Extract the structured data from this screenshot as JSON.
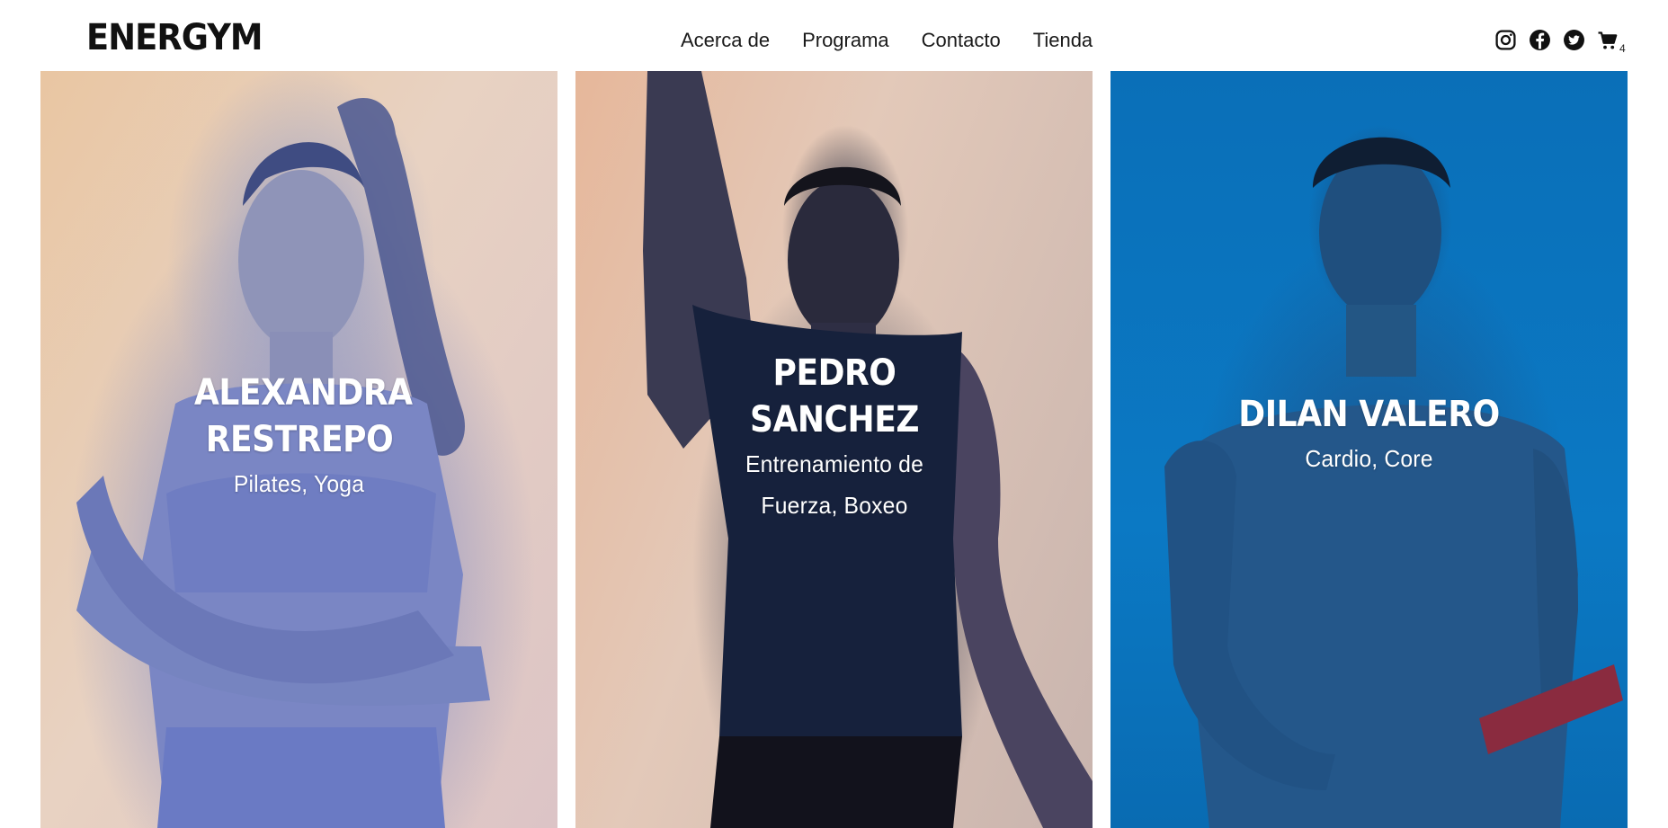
{
  "brand": {
    "logo_text": "ENERGYM"
  },
  "nav": {
    "items": [
      {
        "label": "Acerca de"
      },
      {
        "label": "Programa"
      },
      {
        "label": "Contacto"
      },
      {
        "label": "Tienda"
      }
    ]
  },
  "social": {
    "icons": [
      "instagram-icon",
      "facebook-icon",
      "twitter-icon"
    ],
    "cart_icon": "cart-icon",
    "cart_count": "4"
  },
  "trainers": [
    {
      "name": "ALEXANDRA RESTREPO",
      "specialty": "Pilates, Yoga",
      "background_color": "#e8cbb3",
      "clothing_color": "#7482c6"
    },
    {
      "name": "PEDRO SANCHEZ",
      "specialty": "Entrenamiento de Fuerza, Boxeo",
      "background_color": "#e4c4b2",
      "clothing_color": "#1a2440"
    },
    {
      "name": "DILAN VALERO",
      "specialty": "Cardio, Core",
      "background_color": "#0b75c0",
      "clothing_color": "#1f4e82"
    }
  ]
}
